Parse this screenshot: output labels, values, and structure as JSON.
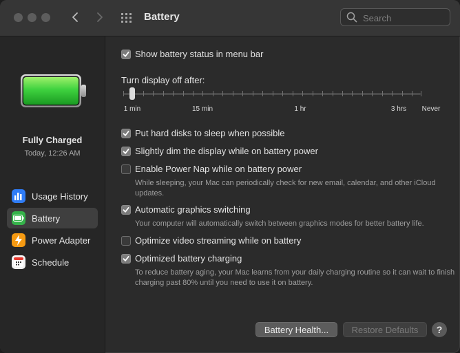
{
  "window": {
    "title": "Battery"
  },
  "search": {
    "placeholder": "Search"
  },
  "status": {
    "title": "Fully Charged",
    "time": "Today, 12:26 AM",
    "charge_level": 1.0
  },
  "sidebar": {
    "items": [
      {
        "label": "Usage History",
        "icon": "bar-chart-icon",
        "color": "#2f7cf6"
      },
      {
        "label": "Battery",
        "icon": "battery-icon",
        "color": "#35b34a"
      },
      {
        "label": "Power Adapter",
        "icon": "lightning-icon",
        "color": "#f59a12"
      },
      {
        "label": "Schedule",
        "icon": "calendar-icon",
        "color": "#f2f2f2"
      }
    ],
    "selected": "Battery"
  },
  "options": [
    {
      "label": "Show battery status in menu bar",
      "checked": true
    },
    {
      "label": "Put hard disks to sleep when possible",
      "checked": true
    },
    {
      "label": "Slightly dim the display while on battery power",
      "checked": true
    },
    {
      "label": "Enable Power Nap while on battery power",
      "checked": false,
      "description": "While sleeping, your Mac can periodically check for new email, calendar, and other iCloud updates."
    },
    {
      "label": "Automatic graphics switching",
      "checked": true,
      "description": "Your computer will automatically switch between graphics modes for better battery life."
    },
    {
      "label": "Optimize video streaming while on battery",
      "checked": false
    },
    {
      "label": "Optimized battery charging",
      "checked": true,
      "description": "To reduce battery aging, your Mac learns from your daily charging routine so it can wait to finish charging past 80% until you need to use it on battery."
    }
  ],
  "display_off": {
    "label": "Turn display off after:",
    "tick_labels": [
      "1 min",
      "15 min",
      "1 hr",
      "3 hrs",
      "Never"
    ],
    "value": "1 min"
  },
  "buttons": {
    "health": "Battery Health...",
    "restore": "Restore Defaults",
    "help": "?"
  },
  "colors": {
    "accent_battery": "#3fd23f"
  }
}
